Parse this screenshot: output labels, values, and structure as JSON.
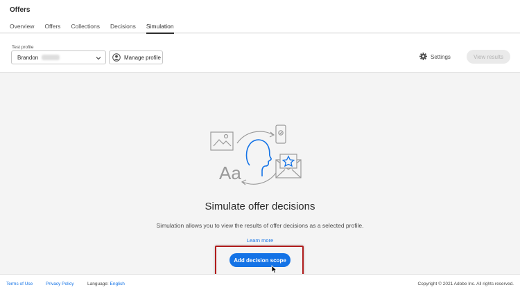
{
  "app": {
    "title": "Offers"
  },
  "tabs": [
    {
      "label": "Overview"
    },
    {
      "label": "Offers"
    },
    {
      "label": "Collections"
    },
    {
      "label": "Decisions"
    },
    {
      "label": "Simulation",
      "active": true
    }
  ],
  "toolbar": {
    "test_profile_label": "Test profile",
    "profile_value": "Brandon",
    "manage_profile_label": "Manage profile",
    "settings_label": "Settings",
    "view_results_label": "View results"
  },
  "empty_state": {
    "title": "Simulate offer decisions",
    "description": "Simulation allows you to view the results of offer decisions as a selected profile.",
    "learn_more": "Learn more",
    "add_scope_label": "Add decision scope",
    "illustration_text": "Aa"
  },
  "footer": {
    "terms": "Terms of Use",
    "privacy": "Privacy Policy",
    "language_label": "Language:",
    "language_value": "English",
    "copyright": "Copyright © 2021 Adobe Inc. All rights reserved."
  },
  "colors": {
    "accent": "#1473e6",
    "highlight": "#b01c1c",
    "background": "#f4f4f4"
  },
  "icons": [
    "chevron-down-icon",
    "user-circle-icon",
    "gear-icon",
    "mouse-cursor-icon"
  ]
}
